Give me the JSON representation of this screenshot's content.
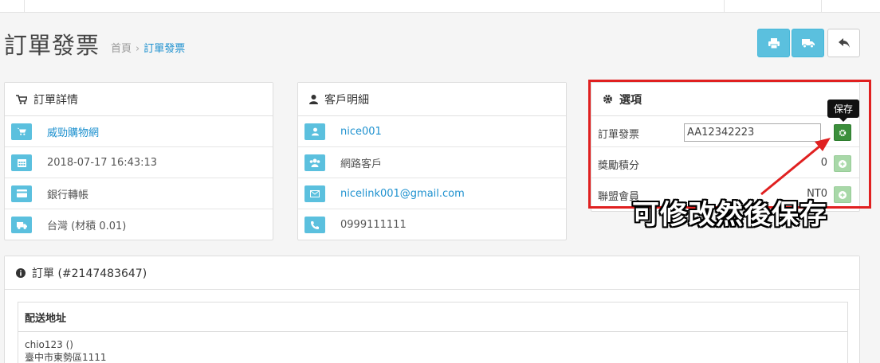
{
  "header": {
    "title": "訂單發票",
    "breadcrumb": {
      "home": "首頁",
      "separator": "›",
      "current": "訂單發票"
    },
    "buttons": [
      {
        "name": "print-button",
        "icon": "print-icon"
      },
      {
        "name": "shipping-button",
        "icon": "truck-icon"
      },
      {
        "name": "back-button",
        "icon": "reply-icon"
      }
    ]
  },
  "order_details": {
    "title": "訂單詳情",
    "store": "威勁購物網",
    "date": "2018-07-17 16:43:13",
    "payment": "銀行轉帳",
    "shipping": "台灣 (材積 0.01)"
  },
  "customer": {
    "title": "客戶明細",
    "username": "nice001",
    "group": "網路客戶",
    "email": "nicelink001@gmail.com",
    "phone": "0999111111"
  },
  "options": {
    "title": "選項",
    "rows": [
      {
        "label": "訂單發票",
        "value": "AA12342223"
      },
      {
        "label": "獎勵積分",
        "value": "0"
      },
      {
        "label": "聯盟會員",
        "value": "NT0"
      }
    ],
    "tooltip": "保存"
  },
  "annotation": {
    "text": "可修改然後保存",
    "color": "#e02020"
  },
  "order": {
    "title": "訂單 (#2147483647)",
    "address_heading": "配送地址",
    "address_line1": "chio123 ()",
    "address_line2": "臺中市東勢區1111"
  },
  "colors": {
    "accent": "#5bc0de",
    "link": "#1e91cf",
    "success": "#3c8f3c",
    "highlight": "#e02020"
  }
}
